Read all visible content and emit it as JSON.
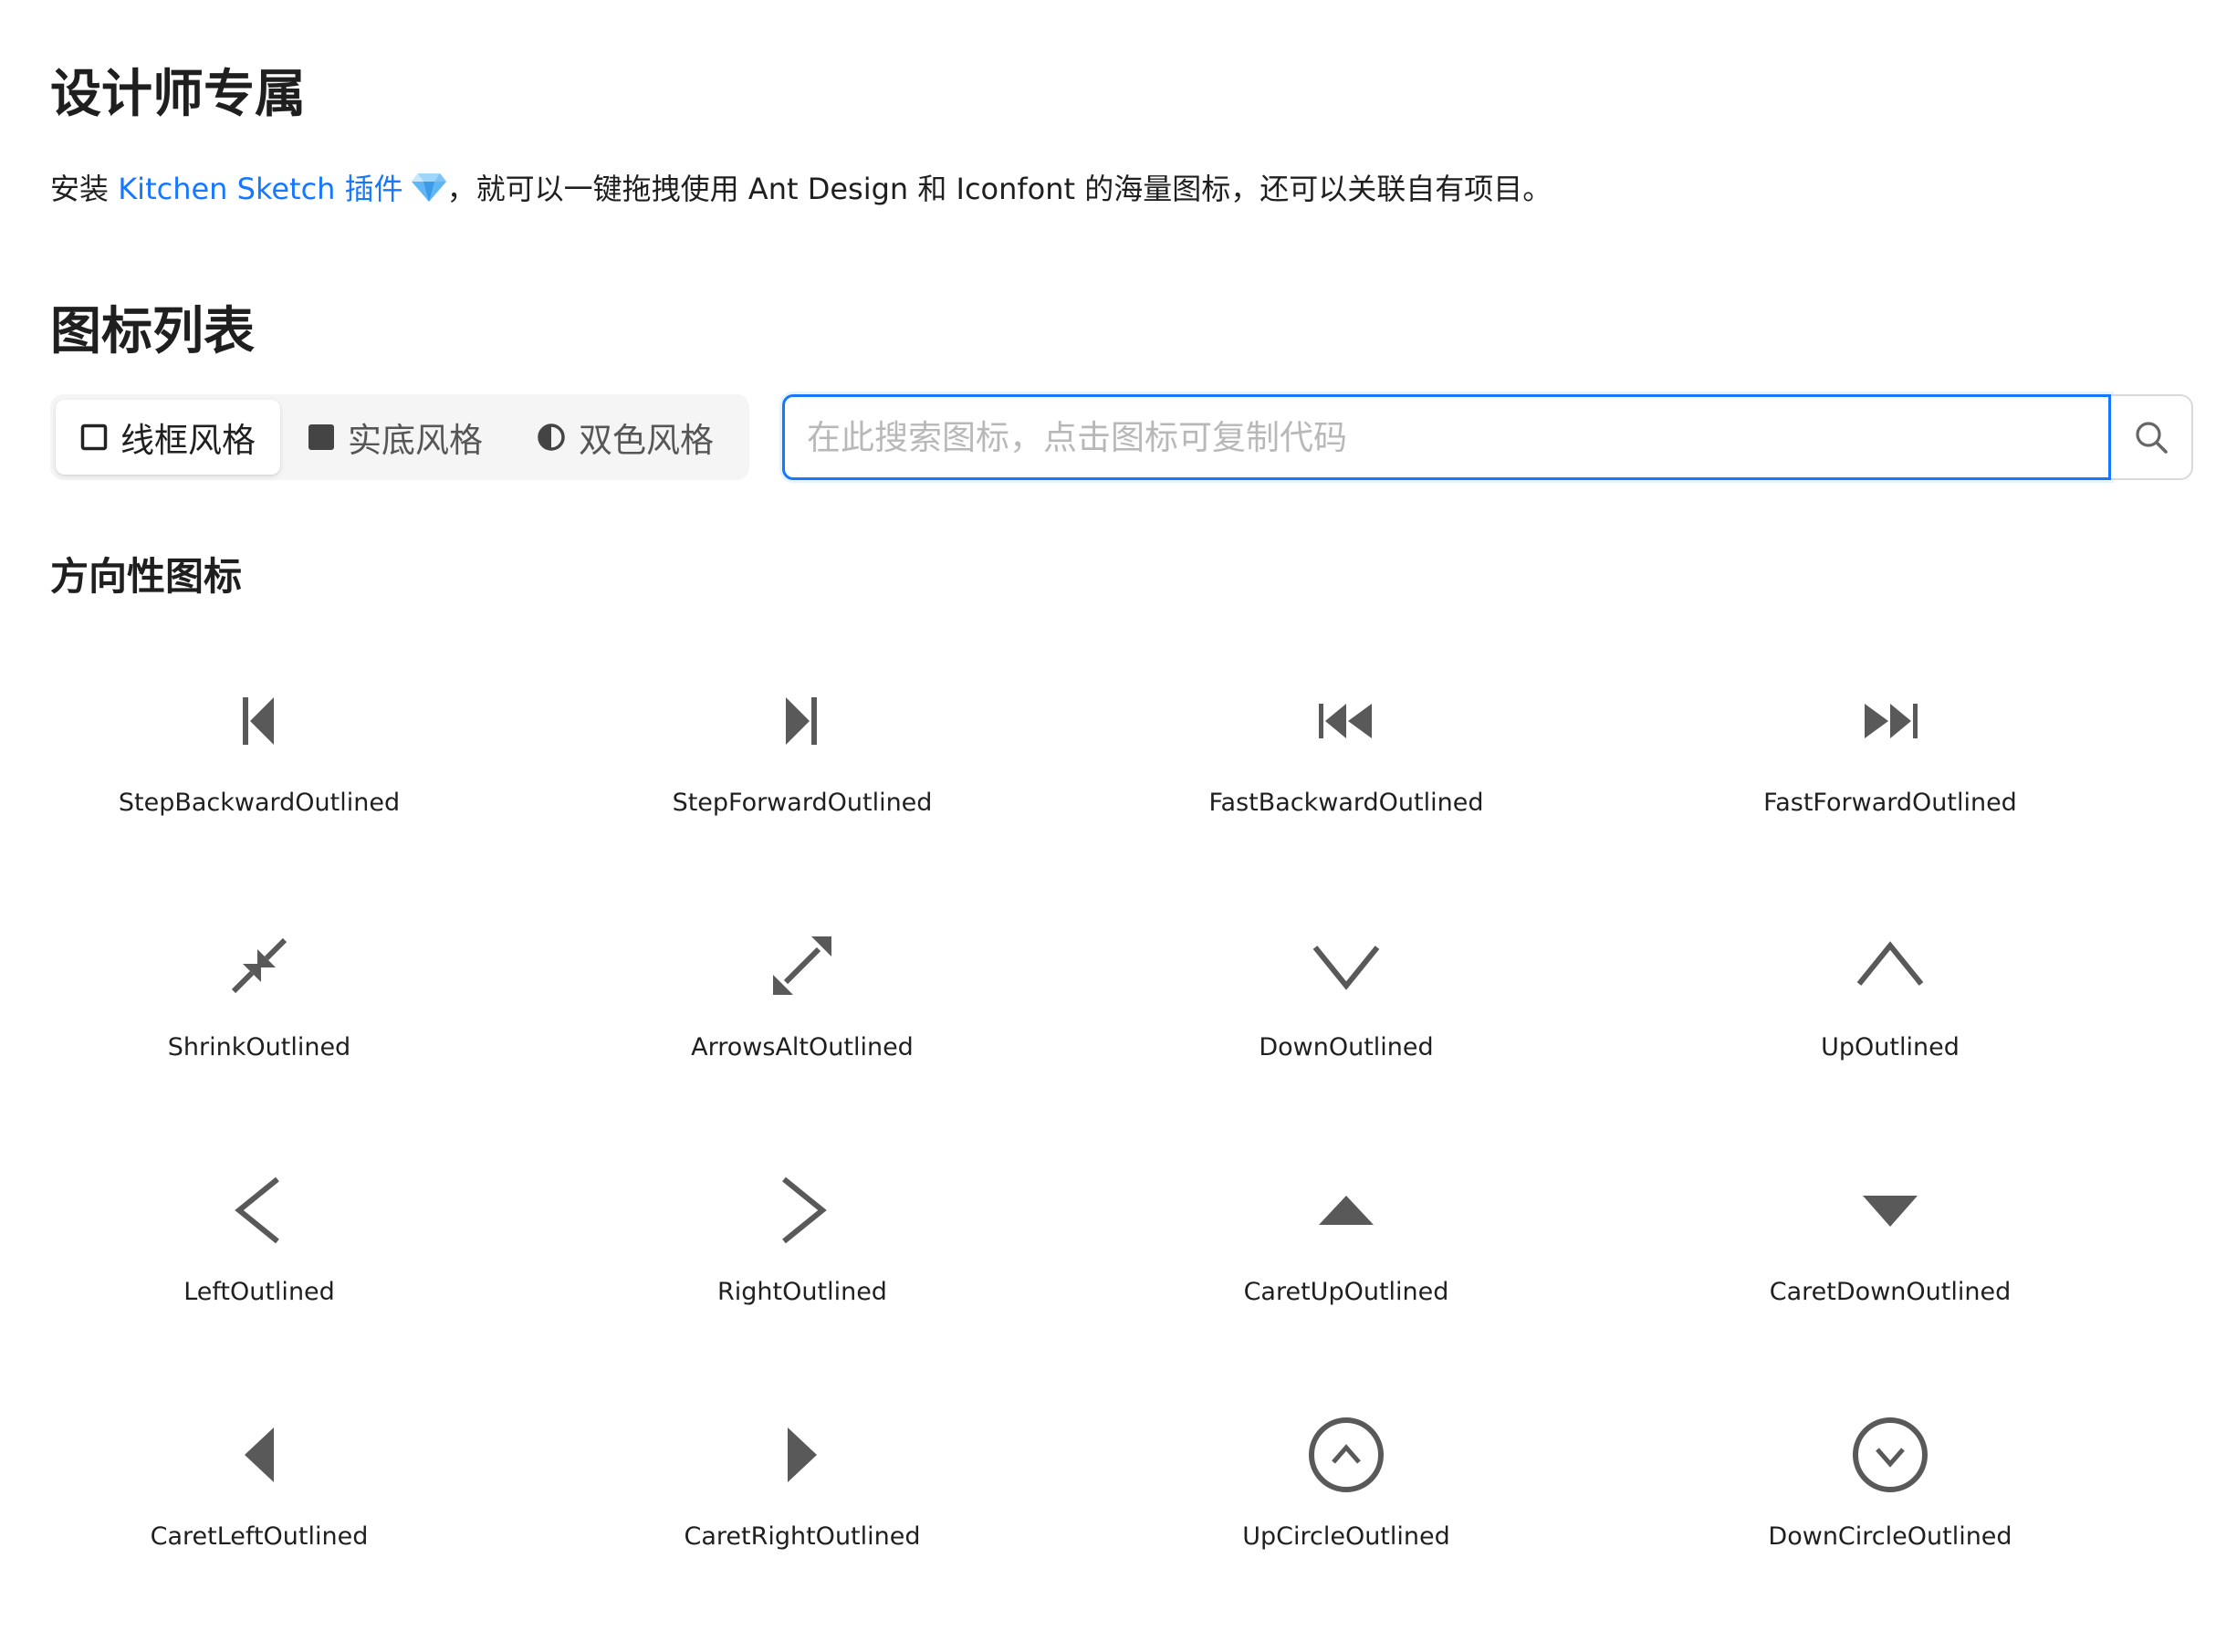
{
  "designer": {
    "title": "设计师专属",
    "intro_prefix": "安装 ",
    "intro_link": "Kitchen Sketch 插件",
    "intro_suffix": "，就可以一键拖拽使用 Ant Design 和 Iconfont 的海量图标，还可以关联自有项目。"
  },
  "icon_list": {
    "title": "图标列表",
    "segmented": [
      {
        "label": "线框风格",
        "icon": "outlined-square-icon",
        "active": true
      },
      {
        "label": "实底风格",
        "icon": "filled-square-icon",
        "active": false
      },
      {
        "label": "双色风格",
        "icon": "half-circle-icon",
        "active": false
      }
    ],
    "search": {
      "placeholder": "在此搜索图标，点击图标可复制代码",
      "value": ""
    }
  },
  "section": {
    "title": "方向性图标",
    "icons": [
      {
        "name": "StepBackwardOutlined"
      },
      {
        "name": "StepForwardOutlined"
      },
      {
        "name": "FastBackwardOutlined"
      },
      {
        "name": "FastForwardOutlined"
      },
      {
        "name": "ShrinkOutlined"
      },
      {
        "name": "ArrowsAltOutlined"
      },
      {
        "name": "DownOutlined"
      },
      {
        "name": "UpOutlined"
      },
      {
        "name": "LeftOutlined"
      },
      {
        "name": "RightOutlined"
      },
      {
        "name": "CaretUpOutlined"
      },
      {
        "name": "CaretDownOutlined"
      },
      {
        "name": "CaretLeftOutlined"
      },
      {
        "name": "CaretRightOutlined"
      },
      {
        "name": "UpCircleOutlined"
      },
      {
        "name": "DownCircleOutlined"
      }
    ]
  },
  "colors": {
    "link": "#1677ff",
    "icon": "#595959",
    "focus_border": "#1677ff"
  }
}
